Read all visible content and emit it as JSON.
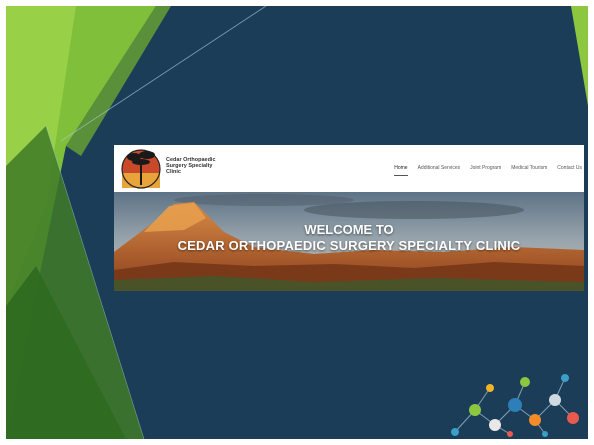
{
  "clinic": {
    "name_lines": [
      "Cedar Orthopaedic",
      "Surgery Specialty",
      "Clinic"
    ]
  },
  "nav": {
    "items": [
      {
        "label": "Home",
        "active": true
      },
      {
        "label": "Additional Services",
        "active": false
      },
      {
        "label": "Joint Program",
        "active": false
      },
      {
        "label": "Medical Tourism",
        "active": false
      },
      {
        "label": "Contact Us",
        "active": false
      }
    ]
  },
  "hero": {
    "line1": "WELCOME TO",
    "line2": "CEDAR ORTHOPAEDIC SURGERY SPECIALTY CLINIC"
  },
  "colors": {
    "slide_background": "#1b3d58",
    "accent_green": "#8dc63f",
    "dark_green": "#4f8a2b"
  },
  "icons": [
    "logo-tree-icon",
    "network-graphic-icon"
  ]
}
